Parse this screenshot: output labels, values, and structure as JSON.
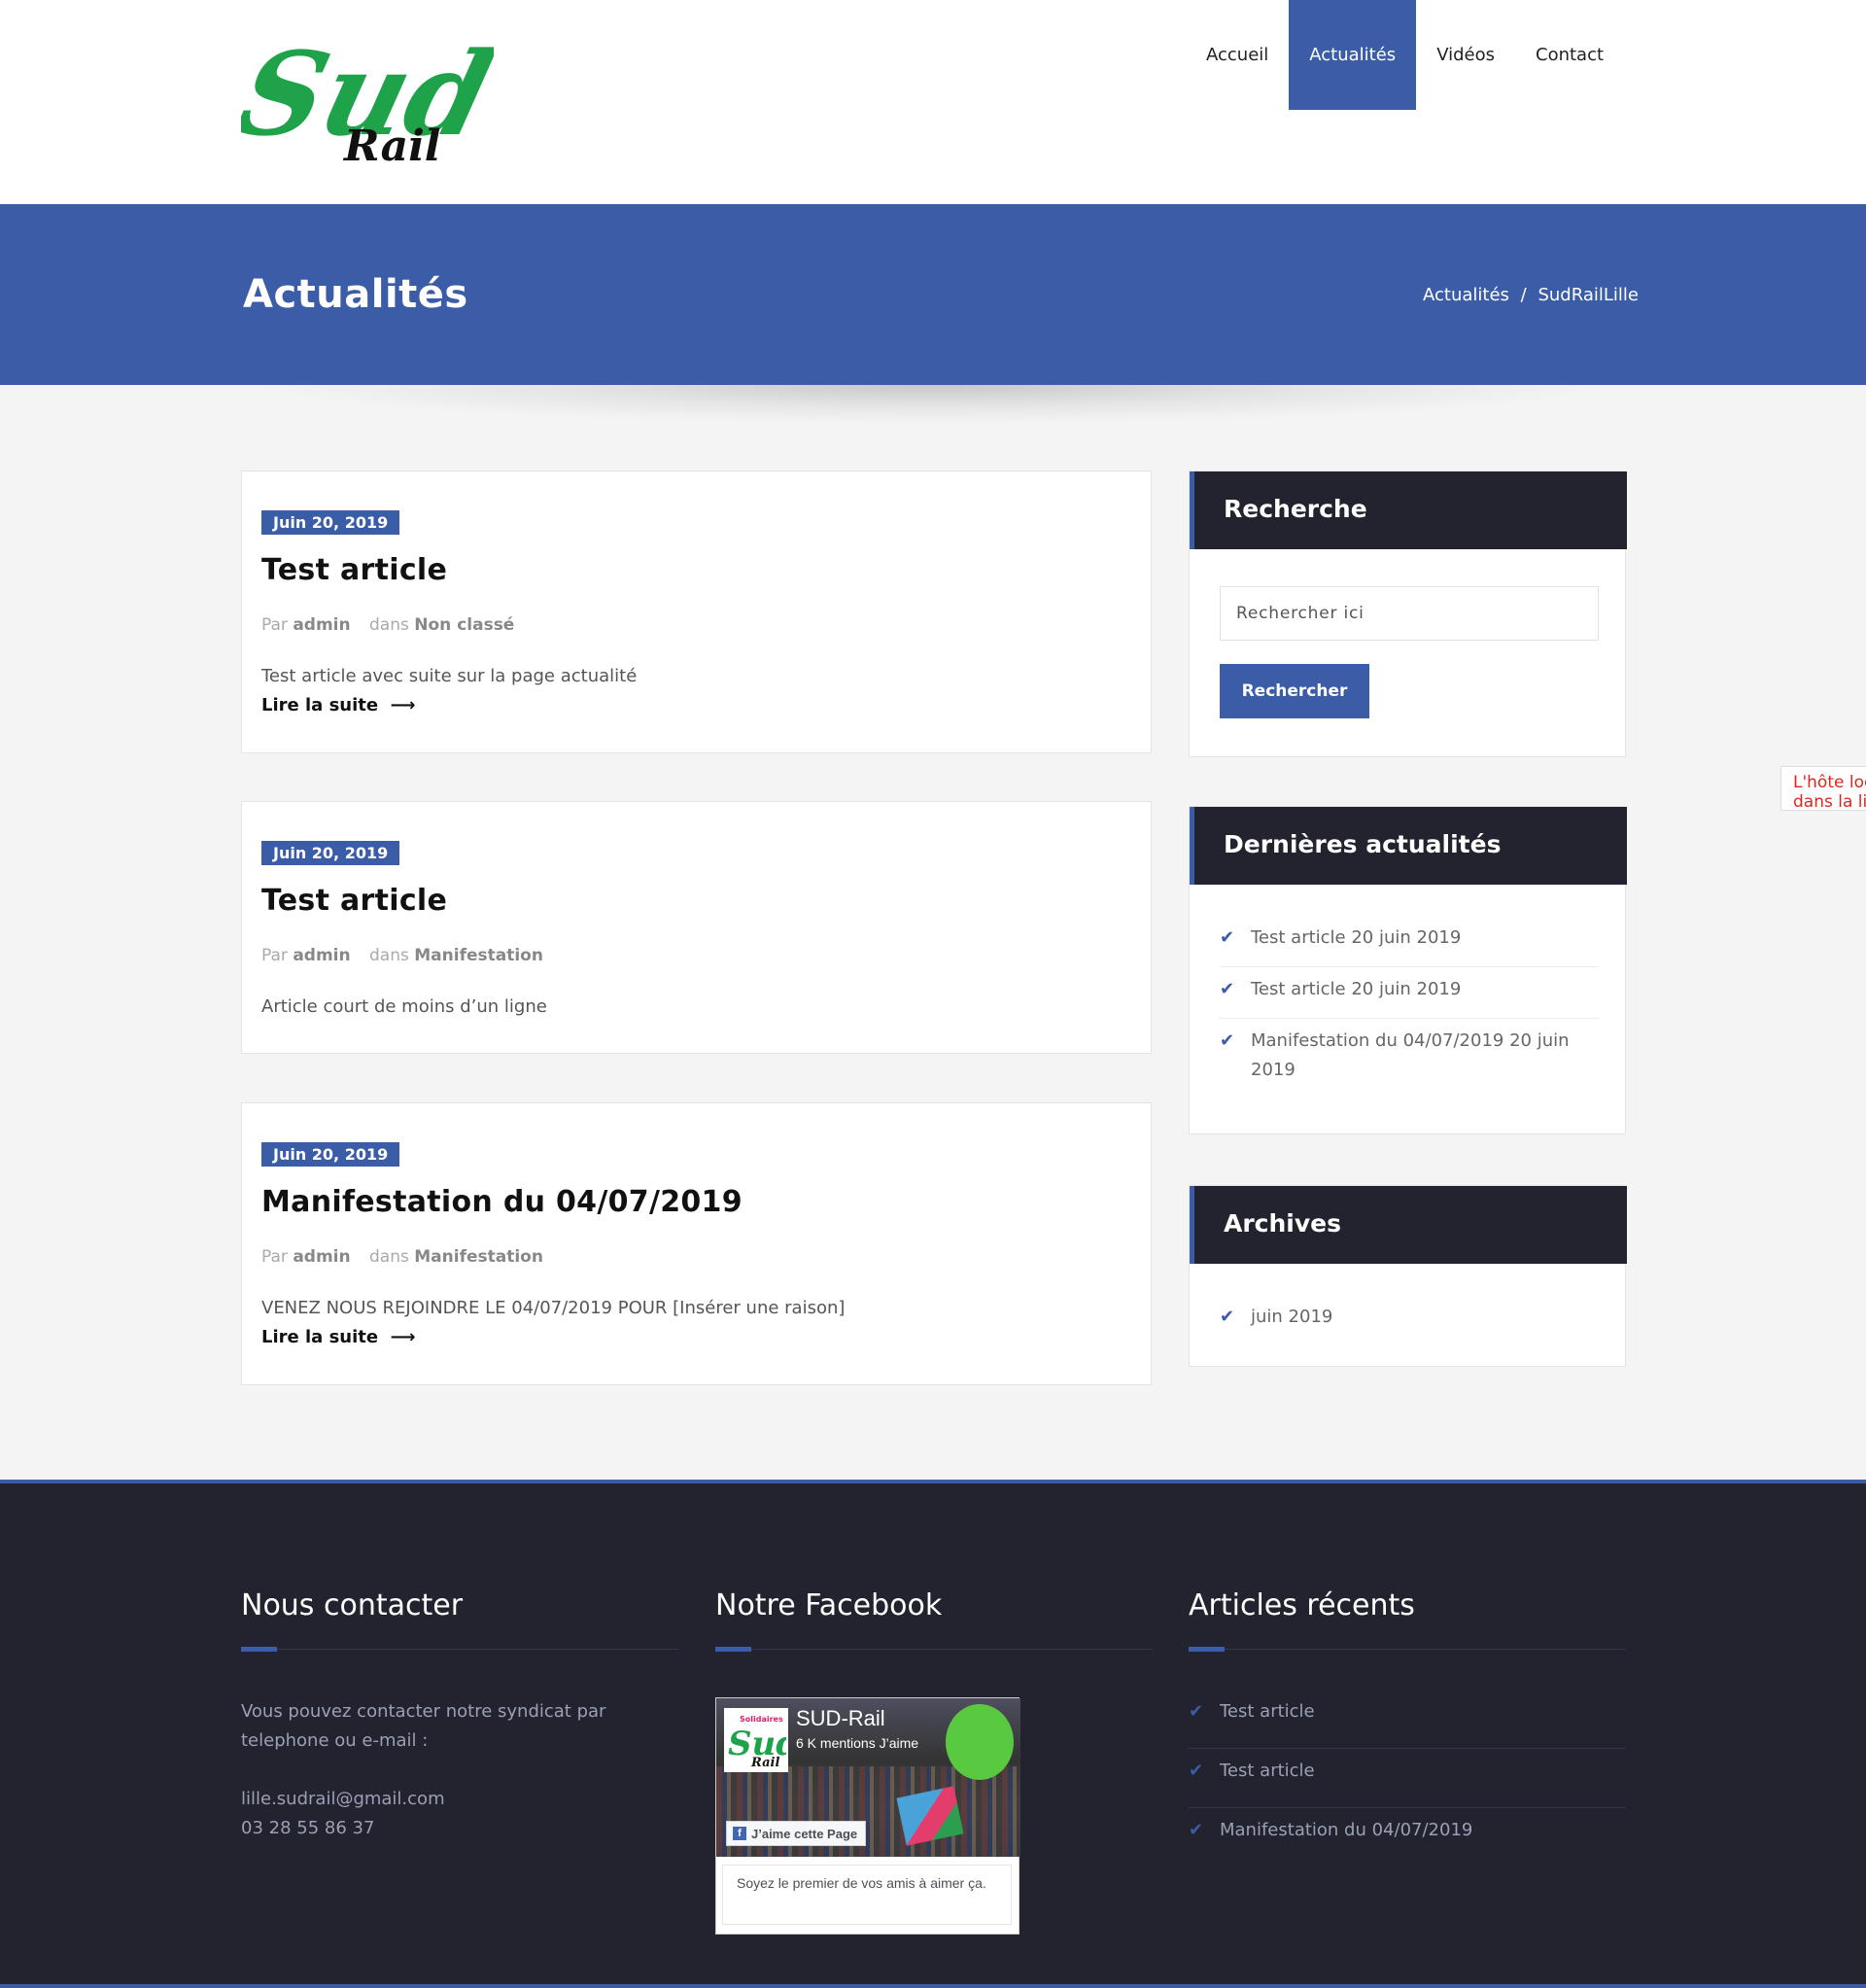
{
  "colors": {
    "accent": "#3b5ca7",
    "dark": "#22232e",
    "error": "#e0261c"
  },
  "header": {
    "logo_text": {
      "main": "Sud",
      "sub": "Rail"
    },
    "nav": [
      {
        "label": "Accueil"
      },
      {
        "label": "Actualités",
        "active": true
      },
      {
        "label": "Vidéos"
      },
      {
        "label": "Contact"
      }
    ]
  },
  "banner": {
    "title": "Actualités",
    "breadcrumb": {
      "item1": "Actualités",
      "separator": "/",
      "item2": "SudRailLille"
    }
  },
  "posts": [
    {
      "date": "Juin 20, 2019",
      "title": "Test article",
      "by_label": "Par",
      "author": "admin",
      "in_label": "dans",
      "category": "Non classé",
      "excerpt": "Test article avec suite sur la page actualité",
      "read_more": "Lire la suite"
    },
    {
      "date": "Juin 20, 2019",
      "title": "Test article",
      "by_label": "Par",
      "author": "admin",
      "in_label": "dans",
      "category": "Manifestation",
      "excerpt": "Article court de moins d’un ligne"
    },
    {
      "date": "Juin 20, 2019",
      "title": "Manifestation du 04/07/2019",
      "by_label": "Par",
      "author": "admin",
      "in_label": "dans",
      "category": "Manifestation",
      "excerpt": "VENEZ NOUS REJOINDRE LE 04/07/2019 POUR [Insérer une raison]",
      "read_more": "Lire la suite"
    }
  ],
  "sidebar": {
    "search": {
      "title": "Recherche",
      "placeholder": "Rechercher ici",
      "button": "Rechercher"
    },
    "recent": {
      "title": "Dernières actualités",
      "items": [
        {
          "label": "Test article 20 juin 2019"
        },
        {
          "label": "Test article 20 juin 2019"
        },
        {
          "label": "Manifestation du 04/07/2019 20 juin 2019"
        }
      ]
    },
    "archives": {
      "title": "Archives",
      "items": [
        {
          "label": "juin 2019"
        }
      ]
    }
  },
  "edge_popup": {
    "line1": "L'hôte loc",
    "line2": "dans la lis"
  },
  "footer": {
    "contact": {
      "title": "Nous contacter",
      "text": "Vous pouvez contacter notre syndicat par telephone ou e-mail :",
      "email": "lille.sudrail@gmail.com",
      "phone": "03 28 55 86 37"
    },
    "facebook": {
      "title": "Notre Facebook",
      "page_name": "SUD-Rail",
      "likes": "6 K mentions J’aime",
      "like_button": "J’aime cette Page",
      "logo_label": "Solidaires",
      "footer_text": "Soyez le premier de vos amis à aimer ça."
    },
    "recent": {
      "title": "Articles récents",
      "items": [
        {
          "label": "Test article"
        },
        {
          "label": "Test article"
        },
        {
          "label": "Manifestation du 04/07/2019"
        }
      ]
    }
  }
}
